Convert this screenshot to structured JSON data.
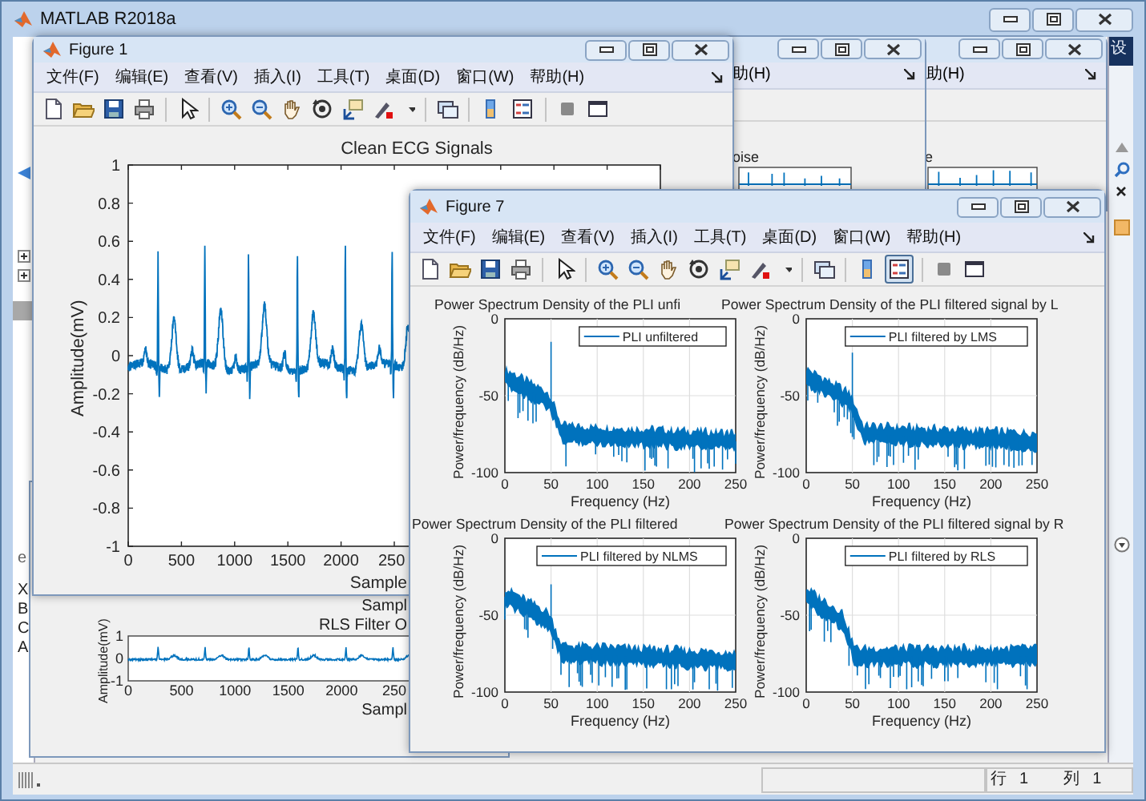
{
  "main_window": {
    "title": "MATLAB R2018a",
    "right_tab_fragment": "设",
    "left_panel_fragments": [
      "e",
      "X",
      "B",
      "C",
      "A"
    ],
    "status_bar": {
      "row_label": "行",
      "row_value": "1",
      "column_label": "列",
      "column_value": "1"
    }
  },
  "background_windows": [
    {
      "menu_fragment": "助(H)",
      "title_fragment": "oise"
    },
    {
      "menu_fragment": "助(H)",
      "title_fragment": "e"
    }
  ],
  "rls_window": {
    "upper_xlabel": "Sampl",
    "title": "RLS Filter O",
    "ylabel": "Amplitude(mV)",
    "yticks": [
      "1",
      "0",
      "-1"
    ],
    "xticks": [
      "0",
      "500",
      "1000",
      "1500",
      "2000",
      "250"
    ],
    "xlabel": "Sampl"
  },
  "figure1": {
    "title": "Figure 1",
    "menu": [
      "文件(F)",
      "编辑(E)",
      "查看(V)",
      "插入(I)",
      "工具(T)",
      "桌面(D)",
      "窗口(W)",
      "帮助(H)"
    ],
    "legend_tool_on": false,
    "axes": {
      "title": "Clean ECG Signals",
      "ylabel": "Amplitude(mV)",
      "xlabel": "Sample",
      "yticks": [
        "1",
        "0.8",
        "0.6",
        "0.4",
        "0.2",
        "0",
        "-0.2",
        "-0.4",
        "-0.6",
        "-0.8",
        "-1"
      ],
      "xticks": [
        "0",
        "500",
        "1000",
        "1500",
        "2000",
        "250"
      ]
    }
  },
  "figure7": {
    "title": "Figure 7",
    "menu": [
      "文件(F)",
      "编辑(E)",
      "查看(V)",
      "插入(I)",
      "工具(T)",
      "桌面(D)",
      "窗口(W)",
      "帮助(H)"
    ],
    "legend_tool_on": true,
    "subplots": [
      {
        "title": "Power Spectrum Density of the PLI unfi",
        "legend": "PLI unfiltered",
        "ylabel": "Power/frequency (dB/Hz)",
        "xlabel": "Frequency (Hz)",
        "yticks": [
          "0",
          "-50",
          "-100"
        ],
        "xticks": [
          "0",
          "50",
          "100",
          "150",
          "200",
          "250"
        ]
      },
      {
        "title": "Power Spectrum Density of the PLI filtered signal by L",
        "legend": "PLI filtered by LMS",
        "ylabel": "Power/frequency (dB/Hz)",
        "xlabel": "Frequency (Hz)",
        "yticks": [
          "0",
          "-50",
          "-100"
        ],
        "xticks": [
          "0",
          "50",
          "100",
          "150",
          "200",
          "250"
        ]
      },
      {
        "title": "Power Spectrum Density of the PLI filtered",
        "legend": "PLI filtered by NLMS",
        "ylabel": "Power/frequency (dB/Hz)",
        "xlabel": "Frequency (Hz)",
        "yticks": [
          "0",
          "-50",
          "-100"
        ],
        "xticks": [
          "0",
          "50",
          "100",
          "150",
          "200",
          "250"
        ]
      },
      {
        "title": "Power Spectrum Density of the PLI filtered signal by R",
        "legend": "PLI filtered by RLS",
        "ylabel": "Power/frequency (dB/Hz)",
        "xlabel": "Frequency (Hz)",
        "yticks": [
          "0",
          "-50",
          "-100"
        ],
        "xticks": [
          "0",
          "50",
          "100",
          "150",
          "200",
          "250"
        ]
      }
    ]
  }
}
